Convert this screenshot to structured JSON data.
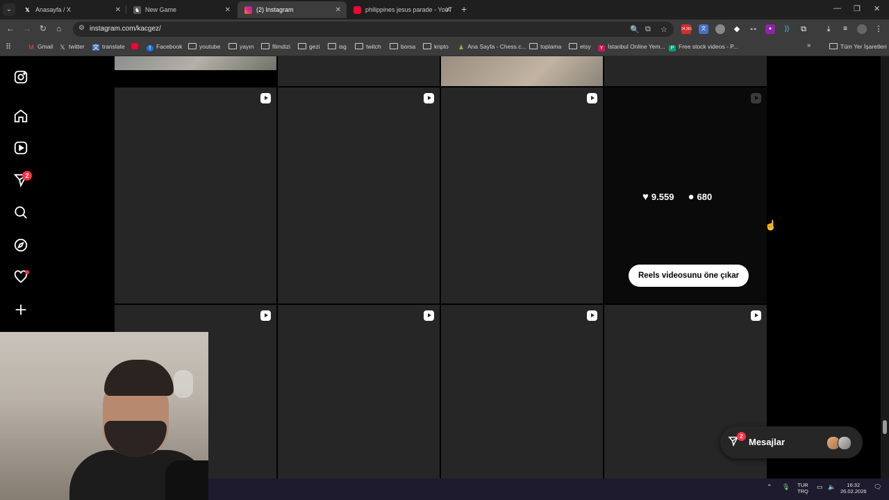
{
  "browser": {
    "tabs": [
      {
        "title": "Anasayfa / X",
        "icon": "x-icon",
        "active": false
      },
      {
        "title": "New Game",
        "icon": "chess-icon",
        "active": false
      },
      {
        "title": "(2) Instagram",
        "icon": "instagram-icon",
        "active": true
      },
      {
        "title": "philippines jesus parade - YouT",
        "icon": "youtube-icon",
        "active": false
      }
    ],
    "url": "instagram.com/kacgez/",
    "extension_badge": "24,361"
  },
  "bookmarks": {
    "items": [
      {
        "label": "Gmail",
        "icon": "gmail-icon"
      },
      {
        "label": "twitter",
        "icon": "x-icon"
      },
      {
        "label": "translate",
        "icon": "translate-icon"
      },
      {
        "label": "",
        "icon": "youtube-icon"
      },
      {
        "label": "Facebook",
        "icon": "facebook-icon"
      },
      {
        "label": "youtube",
        "icon": "folder-icon"
      },
      {
        "label": "yayın",
        "icon": "folder-icon"
      },
      {
        "label": "filmdizi",
        "icon": "folder-icon"
      },
      {
        "label": "gezi",
        "icon": "folder-icon"
      },
      {
        "label": "isg",
        "icon": "folder-icon"
      },
      {
        "label": "twitch",
        "icon": "folder-icon"
      },
      {
        "label": "borsa",
        "icon": "folder-icon"
      },
      {
        "label": "kripto",
        "icon": "folder-icon"
      },
      {
        "label": "Ana Sayfa - Chess.c...",
        "icon": "chess-icon"
      },
      {
        "label": "toplama",
        "icon": "folder-icon"
      },
      {
        "label": "etsy",
        "icon": "folder-icon"
      },
      {
        "label": "İstanbul Online Yem...",
        "icon": "yemeksepeti-icon"
      },
      {
        "label": "Free stock videos - P...",
        "icon": "pexels-icon"
      }
    ],
    "all_bookmarks": "Tüm Yer İşaretleri"
  },
  "instagram": {
    "sidebar_badge": "2",
    "hover_post": {
      "likes": "9.559",
      "comments": "680",
      "boost_button": "Reels videosunu öne çıkar"
    },
    "messages": {
      "label": "Mesajlar",
      "badge": "2"
    }
  },
  "taskbar": {
    "lang_top": "TUR",
    "lang_bottom": "TRQ",
    "time": "16:32",
    "date": "26.02.2026"
  }
}
